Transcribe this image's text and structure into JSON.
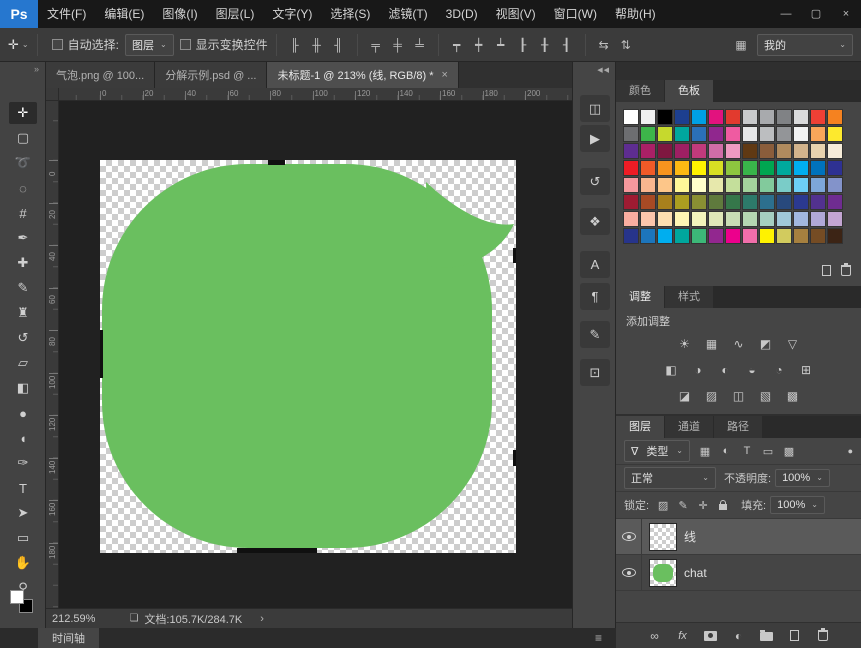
{
  "ui": {
    "caret": "⌄"
  },
  "app": {
    "logo": "Ps",
    "window_controls": [
      "—",
      "▢",
      "×"
    ]
  },
  "menubar": {
    "items": [
      "文件(F)",
      "编辑(E)",
      "图像(I)",
      "图层(L)",
      "文字(Y)",
      "选择(S)",
      "滤镜(T)",
      "3D(D)",
      "视图(V)",
      "窗口(W)",
      "帮助(H)"
    ]
  },
  "options": {
    "tool_icon": "✛",
    "auto_select_label": "自动选择:",
    "auto_select_value": "图层",
    "show_transform_label": "显示变换控件",
    "align_icons": [
      "╟",
      "╫",
      "╢"
    ],
    "align_v_icons": [
      "╤",
      "╪",
      "╧"
    ],
    "distribute_icons": [
      "┯",
      "┿",
      "┷",
      "┠",
      "╂",
      "┨"
    ],
    "extra_icons": [
      "⇆",
      "⇅"
    ],
    "workspace_icon": "▦",
    "workspace_label": "我的"
  },
  "tabs": [
    {
      "label": "气泡.png @ 100...",
      "active": false
    },
    {
      "label": "分解示例.psd @ ...",
      "active": false
    },
    {
      "label": "未标题-1 @ 213% (线, RGB/8) *",
      "active": true
    }
  ],
  "tab_close": "×",
  "toolbar": {
    "expand": "»",
    "tools": [
      {
        "name": "move-tool",
        "glyph": "✛",
        "selected": true
      },
      {
        "name": "marquee-tool",
        "glyph": "▢"
      },
      {
        "name": "lasso-tool",
        "glyph": "➰"
      },
      {
        "name": "quick-selection-tool",
        "glyph": "◌"
      },
      {
        "name": "crop-tool",
        "glyph": "#"
      },
      {
        "name": "eyedropper-tool",
        "glyph": "✒"
      },
      {
        "name": "healing-brush-tool",
        "glyph": "✚"
      },
      {
        "name": "brush-tool",
        "glyph": "✎"
      },
      {
        "name": "clone-stamp-tool",
        "glyph": "♜"
      },
      {
        "name": "history-brush-tool",
        "glyph": "↺"
      },
      {
        "name": "eraser-tool",
        "glyph": "▱"
      },
      {
        "name": "gradient-tool",
        "glyph": "◧"
      },
      {
        "name": "blur-tool",
        "glyph": "●"
      },
      {
        "name": "dodge-tool",
        "glyph": "◖"
      },
      {
        "name": "pen-tool",
        "glyph": "✑"
      },
      {
        "name": "type-tool",
        "glyph": "T"
      },
      {
        "name": "path-selection-tool",
        "glyph": "➤"
      },
      {
        "name": "shape-tool",
        "glyph": "▭"
      },
      {
        "name": "hand-tool",
        "glyph": "✋"
      },
      {
        "name": "zoom-tool",
        "glyph": "⚲"
      }
    ],
    "foreground_color": "#ffffff",
    "background_color": "#000000"
  },
  "rulers": {
    "top": [
      "0",
      "20",
      "40",
      "60",
      "80",
      "100",
      "120",
      "140",
      "160",
      "180",
      "200"
    ],
    "left": [
      "0",
      "20",
      "40",
      "60",
      "80",
      "100",
      "120",
      "140",
      "160",
      "180"
    ]
  },
  "canvas": {
    "bubble_color": "#6abf5f"
  },
  "statusbar": {
    "zoom": "212.59%",
    "doc_icon": "❏",
    "doc_info": "文档:105.7K/284.7K",
    "chevron": "›"
  },
  "timeline": {
    "tab": "时间轴",
    "menu_icon": "≡"
  },
  "midstrip": {
    "collapse": "◀◀",
    "icons": [
      {
        "name": "properties-panel-icon",
        "glyph": "◫"
      },
      {
        "name": "actions-panel-icon",
        "glyph": "▶"
      },
      {
        "name": "history-panel-icon",
        "glyph": "↺"
      },
      {
        "name": "brush-presets-panel-icon",
        "glyph": "❖"
      },
      {
        "name": "character-panel-icon",
        "glyph": "A"
      },
      {
        "name": "paragraph-panel-icon",
        "glyph": "¶"
      },
      {
        "name": "brush-settings-panel-icon",
        "glyph": "✎"
      },
      {
        "name": "clone-source-panel-icon",
        "glyph": "⊡"
      }
    ]
  },
  "panels": {
    "colors": {
      "tabs": [
        "颜色",
        "色板"
      ],
      "active_tab": 1,
      "swatches": [
        "#ffffff",
        "#f0f0f0",
        "#000000",
        "#1d3f8f",
        "#00a0e4",
        "#e2127e",
        "#e23a2e",
        "#c9cacc",
        "#a8aaad",
        "#808285",
        "#d9dadb",
        "#ee4035",
        "#f58220",
        "#6d6e71",
        "#3db54a",
        "#c6d92d",
        "#00a79e",
        "#2b70b8",
        "#90278e",
        "#ef5ba1",
        "#e6e7e8",
        "#bcbec0",
        "#939598",
        "#f1f2f2",
        "#f9a65a",
        "#fde92d",
        "#5e2d91",
        "#aa2066",
        "#7f1740",
        "#9e1f63",
        "#c13a7c",
        "#d06da8",
        "#ef9ac2",
        "#603913",
        "#8a5d3b",
        "#b08b5e",
        "#d3b48c",
        "#e8d3ae",
        "#f6ecd8",
        "#ee1c25",
        "#f05a28",
        "#f7941e",
        "#fdb913",
        "#fff200",
        "#d7df23",
        "#8dc63f",
        "#39b54a",
        "#00a651",
        "#00a99d",
        "#00aeef",
        "#0072bc",
        "#2e3192",
        "#f6989d",
        "#f9b68f",
        "#fdc689",
        "#fff799",
        "#ffffcc",
        "#e7e8ac",
        "#c4df9b",
        "#a3d39c",
        "#82ca9c",
        "#7accc8",
        "#6dcff6",
        "#7da7d9",
        "#8393ca",
        "#9e1b32",
        "#a84a24",
        "#a8801c",
        "#ab9e20",
        "#898f33",
        "#5f7a3d",
        "#35774a",
        "#2d7a6a",
        "#2c6f8e",
        "#28497c",
        "#2b3990",
        "#52318f",
        "#6f2c91",
        "#f9ada0",
        "#fbc5ab",
        "#fddfb0",
        "#fef6b5",
        "#f3f4bc",
        "#dfe7b8",
        "#c9ddb5",
        "#b5d6b2",
        "#a5cfc0",
        "#a0c8d8",
        "#a2b8e0",
        "#b0a8d8",
        "#c3a5d2",
        "#27348b",
        "#1c75bc",
        "#00aeef",
        "#00a79d",
        "#3cb878",
        "#92278f",
        "#ec008c",
        "#f06eaa",
        "#fff200",
        "#d2cb5e",
        "#a6803f",
        "#754c24",
        "#3c2415"
      ]
    },
    "adjustments": {
      "tabs": [
        "调整",
        "样式"
      ],
      "active_tab": 0,
      "add_label": "添加调整",
      "rows": [
        5,
        6,
        5
      ],
      "icons": [
        {
          "name": "brightness-contrast-icon",
          "glyph": "☀"
        },
        {
          "name": "levels-icon",
          "glyph": "▦"
        },
        {
          "name": "curves-icon",
          "glyph": "∿"
        },
        {
          "name": "exposure-icon",
          "glyph": "◩"
        },
        {
          "name": "vibrance-icon",
          "glyph": "▽"
        },
        {
          "name": "hue-saturation-icon",
          "glyph": "◧"
        },
        {
          "name": "color-balance-icon",
          "glyph": "◑"
        },
        {
          "name": "black-white-icon",
          "glyph": "◐"
        },
        {
          "name": "photo-filter-icon",
          "glyph": "◒"
        },
        {
          "name": "channel-mixer-icon",
          "glyph": "◔"
        },
        {
          "name": "color-lookup-icon",
          "glyph": "⊞"
        },
        {
          "name": "invert-icon",
          "glyph": "◪"
        },
        {
          "name": "posterize-icon",
          "glyph": "▨"
        },
        {
          "name": "threshold-icon",
          "glyph": "◫"
        },
        {
          "name": "selective-color-icon",
          "glyph": "▧"
        },
        {
          "name": "gradient-map-icon",
          "glyph": "▩"
        }
      ]
    },
    "layers": {
      "tabs": [
        "图层",
        "通道",
        "路径"
      ],
      "active_tab": 0,
      "filter": {
        "funnel_icon": "∇",
        "type_label": "类型",
        "icons": [
          {
            "name": "pixel-filter-icon",
            "glyph": "▦"
          },
          {
            "name": "adjustment-filter-icon",
            "glyph": "◐"
          },
          {
            "name": "type-filter-icon",
            "glyph": "T"
          },
          {
            "name": "shape-filter-icon",
            "glyph": "▭"
          },
          {
            "name": "smart-object-filter-icon",
            "glyph": "▩"
          }
        ],
        "toggle_icon": "●"
      },
      "blend": {
        "mode": "正常",
        "opacity_label": "不透明度:",
        "opacity": "100%"
      },
      "lock": {
        "label": "锁定:",
        "icons": [
          "▨",
          "✎",
          "✛"
        ],
        "fill_label": "填充:",
        "fill": "100%"
      },
      "items": [
        {
          "name": "线",
          "selected": true,
          "thumb": "checker"
        },
        {
          "name": "chat",
          "selected": false,
          "thumb": "bubble"
        }
      ],
      "footer": {
        "link_icon": "∞",
        "fx_label": "fx",
        "adjust_icon": "◐"
      }
    }
  }
}
